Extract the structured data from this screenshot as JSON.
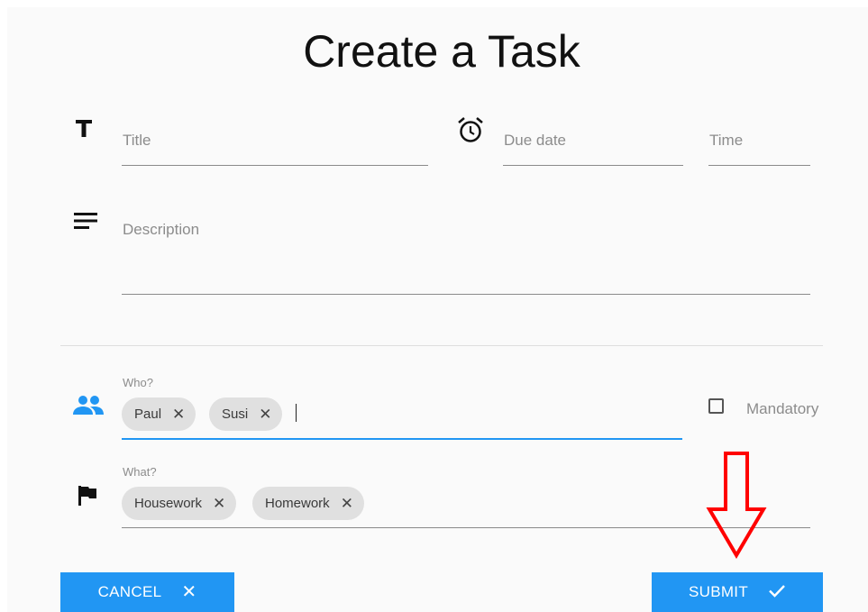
{
  "form": {
    "title": "Create a Task",
    "title_field": {
      "placeholder": "Title",
      "icon": "title-icon"
    },
    "due_date": {
      "placeholder": "Due date",
      "icon": "alarm-clock-icon"
    },
    "time": {
      "placeholder": "Time"
    },
    "description": {
      "placeholder": "Description",
      "icon": "description-icon"
    },
    "who": {
      "label": "Who?",
      "icon": "people-icon",
      "chips": [
        {
          "label": "Paul"
        },
        {
          "label": "Susi"
        }
      ],
      "accent_color": "#2196f3"
    },
    "mandatory": {
      "label": "Mandatory",
      "checked": false
    },
    "what": {
      "label": "What?",
      "icon": "flag-icon",
      "chips": [
        {
          "label": "Housework"
        },
        {
          "label": "Homework"
        }
      ]
    },
    "actions": {
      "cancel_label": "CANCEL",
      "cancel_icon": "close-icon",
      "submit_label": "SUBMIT",
      "submit_icon": "check-icon",
      "button_color": "#2196f3"
    },
    "annotation": {
      "icon": "red-down-arrow-icon",
      "color": "#ff0000"
    }
  }
}
